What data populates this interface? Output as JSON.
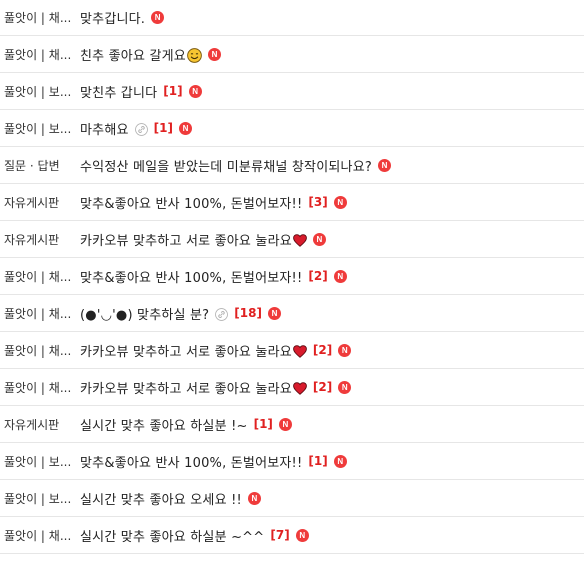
{
  "posts": [
    {
      "board": "풀앗이 | 채...",
      "title": "맞추갑니다.",
      "emoji": "",
      "link": false,
      "count": "",
      "new_badge": "N"
    },
    {
      "board": "풀앗이 | 채...",
      "title": "친추 좋아요 갈게요",
      "emoji": "smile",
      "link": false,
      "count": "",
      "new_badge": "N"
    },
    {
      "board": "풀앗이 | 보...",
      "title": "맞친추 갑니다",
      "emoji": "",
      "link": false,
      "count": "[1]",
      "new_badge": "N"
    },
    {
      "board": "풀앗이 | 보...",
      "title": "마추해요",
      "emoji": "",
      "link": true,
      "count": "[1]",
      "new_badge": "N"
    },
    {
      "board": "질문 · 답변",
      "title": "수익정산 메일을 받았는데 미분류채널 창작이되나요?",
      "emoji": "",
      "link": false,
      "count": "",
      "new_badge": "N"
    },
    {
      "board": "자유게시판",
      "title": "맞추&좋아요 반사 100%, 돈벌어보자!!",
      "emoji": "",
      "link": false,
      "count": "[3]",
      "new_badge": "N"
    },
    {
      "board": "자유게시판",
      "title": "카카오뷰 맞추하고 서로 좋아요 눌라요",
      "emoji": "heart",
      "link": false,
      "count": "",
      "new_badge": "N"
    },
    {
      "board": "풀앗이 | 채...",
      "title": "맞추&좋아요 반사 100%, 돈벌어보자!!",
      "emoji": "",
      "link": false,
      "count": "[2]",
      "new_badge": "N"
    },
    {
      "board": "풀앗이 | 채...",
      "title": "(●'◡'●) 맞추하실 분?",
      "emoji": "",
      "link": true,
      "count": "[18]",
      "new_badge": "N"
    },
    {
      "board": "풀앗이 | 채...",
      "title": "카카오뷰 맞추하고 서로 좋아요 눌라요",
      "emoji": "heart",
      "link": false,
      "count": "[2]",
      "new_badge": "N"
    },
    {
      "board": "풀앗이 | 채...",
      "title": "카카오뷰 맞추하고 서로 좋아요 눌라요",
      "emoji": "heart",
      "link": false,
      "count": "[2]",
      "new_badge": "N"
    },
    {
      "board": "자유게시판",
      "title": "실시간 맞추 좋아요 하실분 !~",
      "emoji": "",
      "link": false,
      "count": "[1]",
      "new_badge": "N"
    },
    {
      "board": "풀앗이 | 보...",
      "title": "맞추&좋아요 반사 100%, 돈벌어보자!!",
      "emoji": "",
      "link": false,
      "count": "[1]",
      "new_badge": "N"
    },
    {
      "board": "풀앗이 | 보...",
      "title": "실시간 맞추 좋아요 오세요 !!",
      "emoji": "",
      "link": false,
      "count": "",
      "new_badge": "N"
    },
    {
      "board": "풀앗이 | 채...",
      "title": "실시간 맞추 좋아요 하실분 ~^^",
      "emoji": "",
      "link": false,
      "count": "[7]",
      "new_badge": "N"
    }
  ],
  "colors": {
    "count": "#e02020",
    "new_badge": "#ef3b3b",
    "divider": "#e6e6e6"
  }
}
